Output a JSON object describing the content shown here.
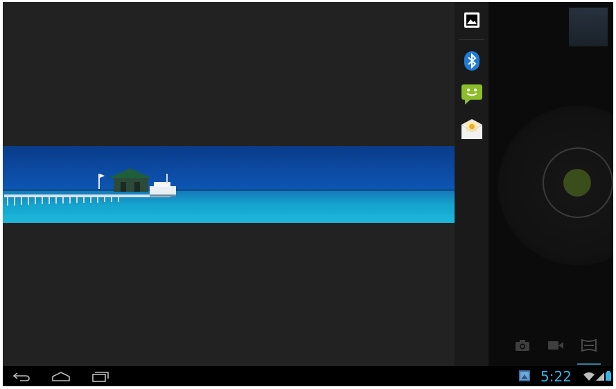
{
  "viewer": {
    "image_name": "seascape-panorama-image"
  },
  "share_strip": {
    "items": [
      {
        "icon": "gallery-icon"
      },
      {
        "icon": "bluetooth-icon"
      },
      {
        "icon": "messaging-icon"
      },
      {
        "icon": "email-icon"
      }
    ]
  },
  "camera": {
    "modes": [
      {
        "icon": "camera-icon"
      },
      {
        "icon": "video-icon"
      },
      {
        "icon": "panorama-icon"
      }
    ],
    "selected_mode": "panorama-icon",
    "shutter_color": "#3c4d1c"
  },
  "navbar": {
    "buttons": [
      {
        "icon": "back-icon"
      },
      {
        "icon": "home-icon"
      },
      {
        "icon": "recent-apps-icon"
      }
    ]
  },
  "status": {
    "time": "5:22",
    "accent": "#33b5e5",
    "icons": [
      "screenshot-notification-icon",
      "wifi-icon",
      "signal-icon",
      "battery-icon"
    ]
  }
}
